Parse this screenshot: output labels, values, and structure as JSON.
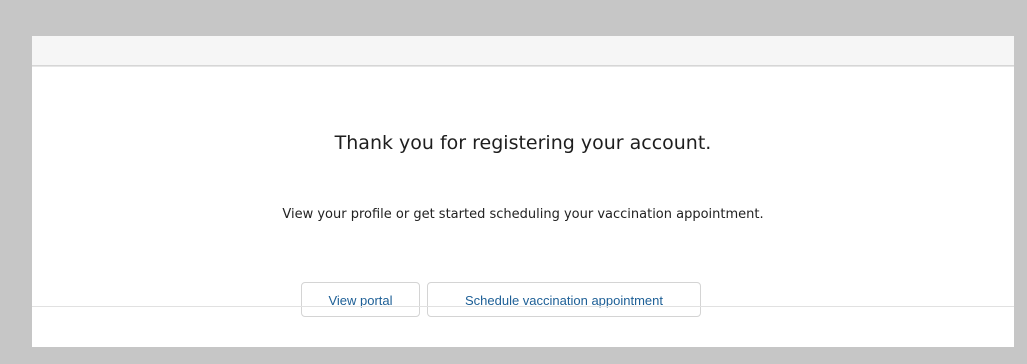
{
  "page": {
    "heading": "Thank you for registering your account.",
    "subtext": "View your profile or get started scheduling your vaccination appointment."
  },
  "actions": {
    "view_portal": "View portal",
    "schedule_appointment": "Schedule vaccination appointment"
  },
  "colors": {
    "outer_background": "#c6c6c6",
    "card_background": "#ffffff",
    "top_bar": "#f6f6f6",
    "button_text": "#1d5f96",
    "button_border": "#d4d4d4"
  }
}
